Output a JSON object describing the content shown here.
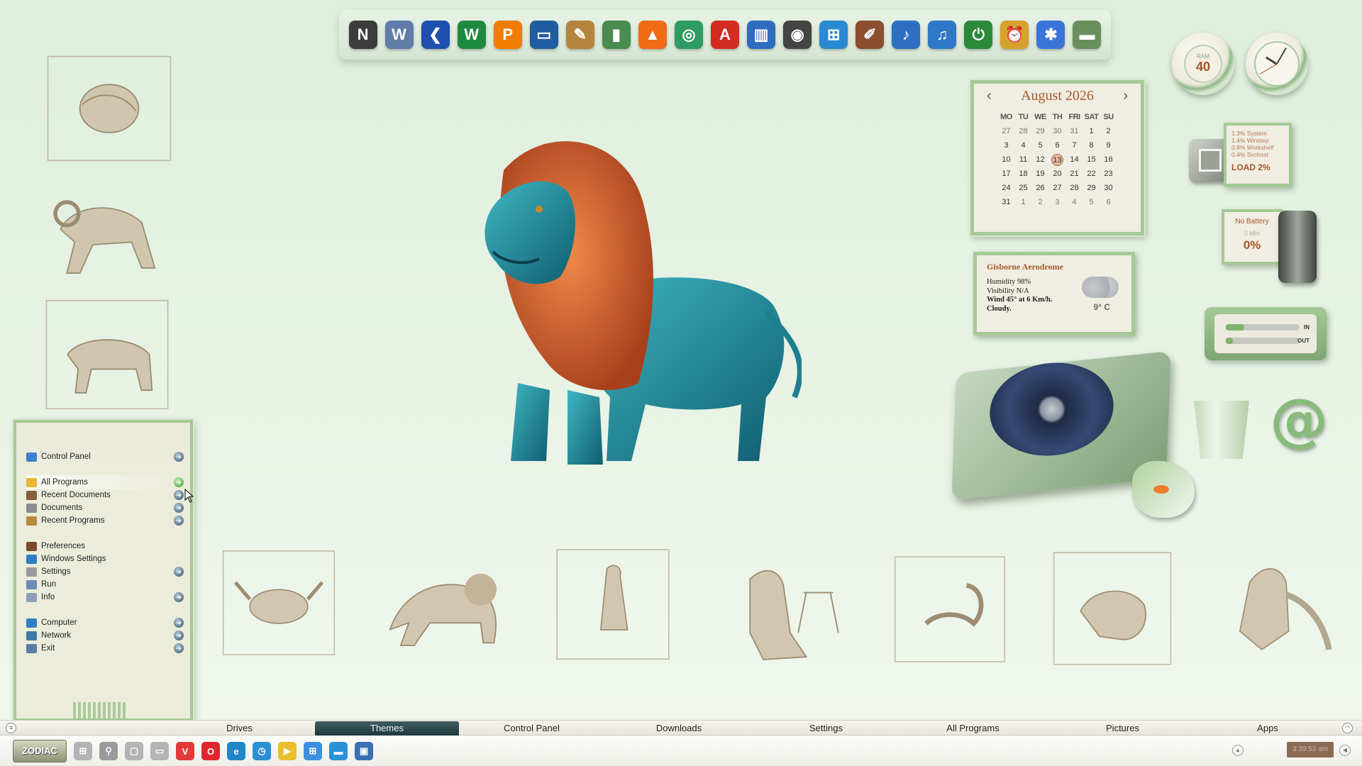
{
  "dock": {
    "icons": [
      {
        "name": "nexus-icon",
        "glyph": "N",
        "color": "#3c3c3c"
      },
      {
        "name": "winstep-icon",
        "glyph": "W",
        "color": "#5f7da8"
      },
      {
        "name": "back-arrow-icon",
        "glyph": "❮",
        "color": "#1e4fae"
      },
      {
        "name": "winamp-icon",
        "glyph": "W",
        "color": "#1e8a3f"
      },
      {
        "name": "potplayer-icon",
        "glyph": "P",
        "color": "#f07d00"
      },
      {
        "name": "monitor-icon",
        "glyph": "▭",
        "color": "#1f5da0"
      },
      {
        "name": "paint-icon",
        "glyph": "✎",
        "color": "#b5853d"
      },
      {
        "name": "recycle-icon",
        "glyph": "▮",
        "color": "#4a8c4f"
      },
      {
        "name": "vlc-icon",
        "glyph": "▲",
        "color": "#f16b15"
      },
      {
        "name": "globe-icon",
        "glyph": "◎",
        "color": "#2f9b62"
      },
      {
        "name": "acrobat-icon",
        "glyph": "A",
        "color": "#d42c20"
      },
      {
        "name": "books-icon",
        "glyph": "▥",
        "color": "#2f6cc0"
      },
      {
        "name": "camera-icon",
        "glyph": "◉",
        "color": "#444"
      },
      {
        "name": "windows-flag-icon",
        "glyph": "⊞",
        "color": "#2a8ad1"
      },
      {
        "name": "brushes-icon",
        "glyph": "✐",
        "color": "#8b4e2e"
      },
      {
        "name": "music-note-icon",
        "glyph": "♪",
        "color": "#2d6fc2"
      },
      {
        "name": "volume-icon",
        "glyph": "♫",
        "color": "#2f78c8"
      },
      {
        "name": "power-icon",
        "glyph": "⏻",
        "color": "#2b8a3a"
      },
      {
        "name": "alarm-clock-icon",
        "glyph": "⏰",
        "color": "#d7a22b"
      },
      {
        "name": "colorful-apps-icon",
        "glyph": "✱",
        "color": "#3b74d8"
      },
      {
        "name": "drive-icon",
        "glyph": "▬",
        "color": "#6a8f5f"
      }
    ]
  },
  "ram_gauge": {
    "label": "RAM",
    "value": "40"
  },
  "clock": {
    "hour": 10,
    "minute": 5,
    "second": 40
  },
  "calendar": {
    "month": "August 2026",
    "weekdays": [
      "MO",
      "TU",
      "WE",
      "TH",
      "FRI",
      "SAT",
      "SU"
    ],
    "weeks": [
      [
        "27",
        "28",
        "29",
        "30",
        "31",
        "1",
        "2"
      ],
      [
        "3",
        "4",
        "5",
        "6",
        "7",
        "8",
        "9"
      ],
      [
        "10",
        "11",
        "12",
        "13",
        "14",
        "15",
        "16"
      ],
      [
        "17",
        "18",
        "19",
        "20",
        "21",
        "22",
        "23"
      ],
      [
        "24",
        "25",
        "26",
        "27",
        "28",
        "29",
        "30"
      ],
      [
        "31",
        "1",
        "2",
        "3",
        "4",
        "5",
        "6"
      ]
    ],
    "today": "13"
  },
  "cpu": {
    "lines": [
      "1.3% System",
      "1.4% Winstep",
      "0.8% Workshelf",
      "0.4% Svchost"
    ],
    "load": "LOAD 2%"
  },
  "battery": {
    "status": "No Battery",
    "time": "0 Min",
    "percent": "0%"
  },
  "network": {
    "in_label": "IN",
    "out_label": "OUT",
    "in_level": 0.25,
    "out_level": 0.1
  },
  "weather": {
    "station": "Gisborne Aerodrome",
    "humidity": "Humidity 98%",
    "visibility": "Visibility N/A",
    "wind": "Wind 45° at 6 Km/h.",
    "condition": "Cloudy.",
    "temperature": "9° C"
  },
  "start_menu": {
    "items": [
      {
        "label": "Control Panel",
        "icon": "control-panel-icon",
        "color": "#3f7fcf",
        "arrow": true
      },
      {
        "label": "All Programs",
        "icon": "folder-icon",
        "color": "#e7b637",
        "arrow": true,
        "active": true
      },
      {
        "label": "Recent Documents",
        "icon": "recent-documents-icon",
        "color": "#8a5d3c",
        "arrow": true
      },
      {
        "label": "Documents",
        "icon": "documents-icon",
        "color": "#8c8c8c",
        "arrow": true
      },
      {
        "label": "Recent Programs",
        "icon": "recent-programs-icon",
        "color": "#b98a3e",
        "arrow": true
      },
      {
        "label": "Preferences",
        "icon": "gear-icon",
        "color": "#7a4a2a",
        "arrow": false
      },
      {
        "label": "Windows Settings",
        "icon": "windows-icon",
        "color": "#2e7cc8",
        "arrow": false
      },
      {
        "label": "Settings",
        "icon": "settings-icon",
        "color": "#9a9a9a",
        "arrow": true
      },
      {
        "label": "Run",
        "icon": "run-icon",
        "color": "#6b8bb3",
        "arrow": false
      },
      {
        "label": "Info",
        "icon": "info-icon",
        "color": "#8ba0b8",
        "arrow": true
      },
      {
        "label": "Computer",
        "icon": "computer-icon",
        "color": "#2f7fc4",
        "arrow": true
      },
      {
        "label": "Network",
        "icon": "network-icon",
        "color": "#3f7aa8",
        "arrow": true
      },
      {
        "label": "Exit",
        "icon": "exit-icon",
        "color": "#5b7ea6",
        "arrow": true
      }
    ],
    "arrow_glyph": "➜"
  },
  "category_bar": {
    "tabs": [
      "Drives",
      "Themes",
      "Control Panel",
      "Downloads",
      "Settings",
      "All Programs",
      "Pictures",
      "Apps"
    ],
    "active": "Themes",
    "left_glyph": "≡",
    "right_glyph": "◠"
  },
  "taskbar": {
    "start_label": "ZODIAC",
    "clock": "3:39:53 am",
    "apps": [
      {
        "name": "task-view-icon",
        "glyph": "⊞",
        "color": "#b4b4b4"
      },
      {
        "name": "search-icon",
        "glyph": "⚲",
        "color": "#9a9a9a"
      },
      {
        "name": "window-icon",
        "glyph": "▢",
        "color": "#b4b4b4"
      },
      {
        "name": "chat-icon",
        "glyph": "▭",
        "color": "#b4b4b4"
      },
      {
        "name": "vivaldi-icon",
        "glyph": "V",
        "color": "#e23a3a"
      },
      {
        "name": "opera-icon",
        "glyph": "O",
        "color": "#e0252f"
      },
      {
        "name": "edge-icon",
        "glyph": "e",
        "color": "#1f86c8"
      },
      {
        "name": "clock-app-icon",
        "glyph": "◷",
        "color": "#2d8fd3"
      },
      {
        "name": "player-icon",
        "glyph": "▶",
        "color": "#e9c02a"
      },
      {
        "name": "windows-icon",
        "glyph": "⊞",
        "color": "#3d8fe0"
      },
      {
        "name": "desktop-icon",
        "glyph": "▬",
        "color": "#2a92d6"
      },
      {
        "name": "monitor-icon",
        "glyph": "▣",
        "color": "#3a6fb3"
      }
    ],
    "tray_up_glyph": "▲",
    "tray_left_glyph": "◀"
  }
}
